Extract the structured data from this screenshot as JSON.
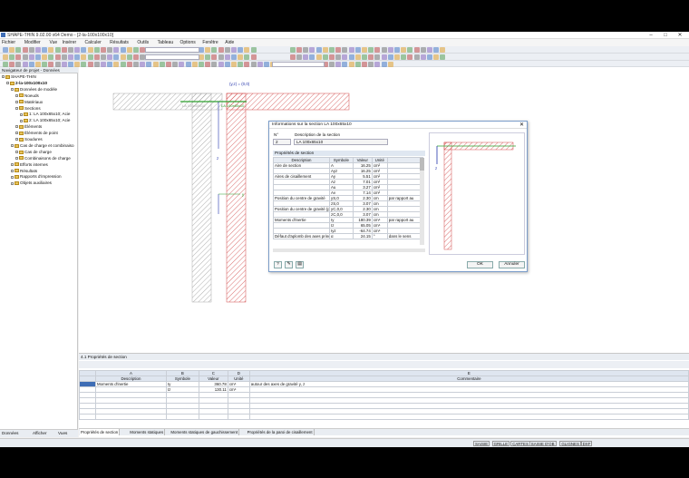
{
  "app": {
    "title": "SHAPE-THIN 9.02.00 x64 Demo - [2-la-100x100x10]"
  },
  "menu": [
    "Fichier",
    "Modifier",
    "Vue",
    "Insérer",
    "Calculer",
    "Résultats",
    "Outils",
    "Tableau",
    "Options",
    "Fenêtre",
    "Aide"
  ],
  "navigator": {
    "title": "Navigateur de projet - Données",
    "root": "SHAPE-THIN",
    "project": "2-la-100x100x10",
    "items": [
      "Données de modèle",
      "Noeuds",
      "Matériaux",
      "Sections",
      "1: LA 100x65x10; Acie",
      "2: LA 100x65x10; Acie",
      "Éléments",
      "Éléments de point",
      "Soudures",
      "Cas de charge et combinaiso",
      "Cas de charge",
      "Combinaisons de charge",
      "Efforts internes",
      "Résultats",
      "Rapports d'impression",
      "Objets auxiliaires"
    ],
    "tabs": [
      "Données",
      "Afficher",
      "Vues"
    ]
  },
  "canvas": {
    "labels": [
      "LA 100x65x10",
      "LA 100x65x10",
      "(y,z) = (0,0)"
    ],
    "axes": [
      "y",
      "z"
    ]
  },
  "dialog": {
    "title": "Informations sur la section LA 100x65x10",
    "no_label": "N°",
    "no_value": "2",
    "desc_label": "Description de la section",
    "desc_value": "LA 100x65x10",
    "props_label": "Propriétés de section",
    "headers": [
      "Description",
      "Symbole",
      "Valeur",
      "Unité"
    ],
    "rows": [
      [
        "Aire de section",
        "A",
        "16.25",
        "cm²"
      ],
      [
        "",
        "Ayz",
        "16.25",
        "cm²"
      ],
      [
        "Aires de cisaillement",
        "Ay",
        "5.51",
        "cm²"
      ],
      [
        "",
        "Az",
        "7.01",
        "cm²"
      ],
      [
        "",
        "Au",
        "3.27",
        "cm²"
      ],
      [
        "",
        "Av",
        "7.14",
        "cm²"
      ],
      [
        "Position du centre de gravité",
        "yS,0",
        "2.30",
        "cm",
        "par rapport au"
      ],
      [
        "",
        "zS,0",
        "3.07",
        "cm",
        ""
      ],
      [
        "Position du centre de gravité (po",
        "yC,0,0",
        "2.30",
        "cm",
        ""
      ],
      [
        "",
        "zC,0,0",
        "3.07",
        "cm",
        ""
      ],
      [
        "Moments d'inertie",
        "Iy",
        "180.39",
        "cm⁴",
        "par rapport au"
      ],
      [
        "",
        "Iz",
        "65.05",
        "cm⁴",
        ""
      ],
      [
        "",
        "Iyz",
        "-64.74",
        "cm⁴",
        ""
      ],
      [
        "Défaut d'aplomb des axes princ",
        "α",
        "24.15",
        "°",
        "dans le sens"
      ]
    ],
    "ok": "OK",
    "cancel": "Annuler"
  },
  "panel": {
    "title": "4.1 Propriétés de section",
    "cols": [
      "A",
      "B",
      "C",
      "D",
      "E"
    ],
    "headers": [
      "Description",
      "Symbole",
      "Valeur",
      "Unité",
      "Commentaire"
    ],
    "rows": [
      [
        "Moments d'inertie",
        "Iy",
        "360.78",
        "cm⁴",
        "autour des axes de gravité y, z"
      ],
      [
        "",
        "Iz",
        "130.11",
        "cm⁴",
        ""
      ]
    ],
    "tabs": [
      "Propriétés de section",
      "Moments statiques",
      "Moments statiques de gauchissement",
      "Propriétés de la paroi de cisaillement"
    ]
  },
  "status": [
    "SAISIE",
    "GRILLE",
    "CARTES",
    "SAISIE D'OB",
    "GLIGNES",
    "DXF"
  ],
  "colors": {
    "hatch": "#d24a4a",
    "accent": "#3e6db5",
    "axis": "#2233aa",
    "green": "#2ea02e"
  }
}
